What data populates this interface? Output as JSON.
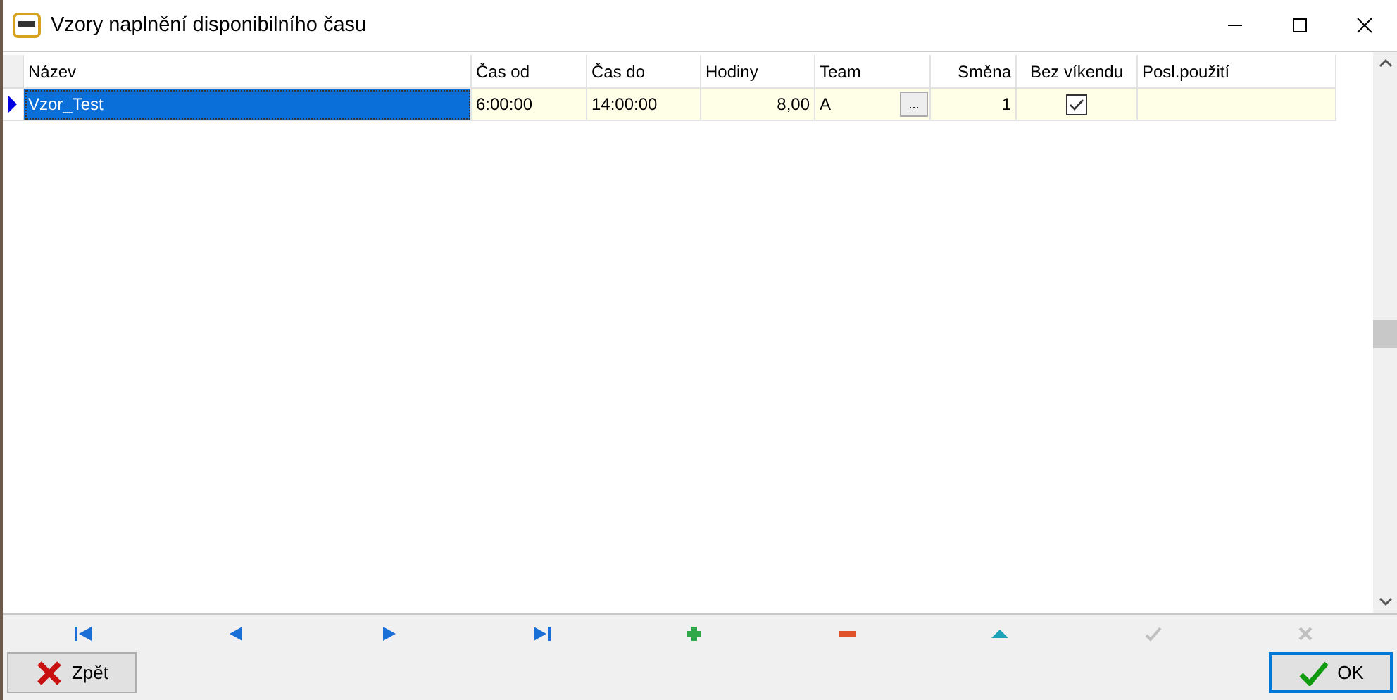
{
  "window": {
    "title": "Vzory naplnění disponibilního času"
  },
  "table": {
    "columns": [
      {
        "label": "Název"
      },
      {
        "label": "Čas od"
      },
      {
        "label": "Čas do"
      },
      {
        "label": "Hodiny"
      },
      {
        "label": "Team"
      },
      {
        "label": "Směna"
      },
      {
        "label": "Bez víkendu"
      },
      {
        "label": "Posl.použití"
      }
    ],
    "rows": [
      {
        "current": true,
        "selected": true,
        "nazev": "Vzor_Test",
        "cas_od": "6:00:00",
        "cas_do": "14:00:00",
        "hodiny": "8,00",
        "team": "A",
        "ellipsis_button": "...",
        "smena": "1",
        "bez_vikendu": true
      }
    ]
  },
  "navigator": [
    {
      "kind": "first",
      "disabled": false
    },
    {
      "kind": "prior",
      "disabled": false
    },
    {
      "kind": "next",
      "disabled": false
    },
    {
      "kind": "last",
      "disabled": false
    },
    {
      "kind": "insert",
      "disabled": false
    },
    {
      "kind": "delete",
      "disabled": false
    },
    {
      "kind": "edit",
      "disabled": false
    },
    {
      "kind": "post",
      "disabled": true
    },
    {
      "kind": "cancel",
      "disabled": true
    }
  ],
  "buttons": [
    {
      "kind": "back",
      "label": "Zpět",
      "default": false
    },
    {
      "kind": "ok",
      "label": "OK",
      "default": true
    }
  ]
}
